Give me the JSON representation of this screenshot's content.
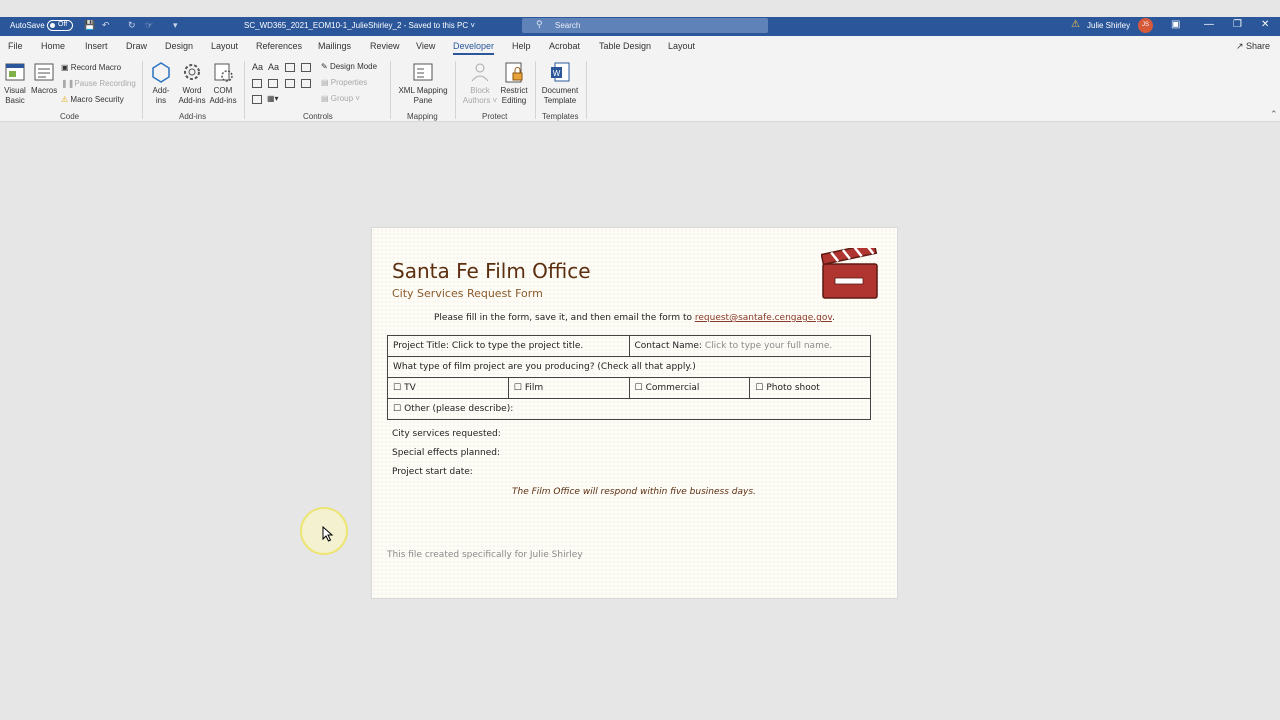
{
  "titlebar": {
    "autosave_label": "AutoSave",
    "autosave_state": "Off",
    "doc_title": "SC_WD365_2021_EOM10-1_JulieShirley_2",
    "save_status": "Saved to this PC",
    "search_placeholder": "Search",
    "user_name": "Julie Shirley",
    "user_initials": "JS"
  },
  "menu": {
    "tabs": [
      "File",
      "Home",
      "Insert",
      "Draw",
      "Design",
      "Layout",
      "References",
      "Mailings",
      "Review",
      "View",
      "Developer",
      "Help",
      "Acrobat",
      "Table Design",
      "Layout"
    ],
    "active_tab": "Developer",
    "share_label": "Share"
  },
  "ribbon": {
    "code": {
      "visual_basic": [
        "Visual",
        "Basic"
      ],
      "macros": "Macros",
      "record_macro": "Record Macro",
      "pause_recording": "Pause Recording",
      "macro_security": "Macro Security",
      "group_label": "Code"
    },
    "addins": {
      "add_ins": [
        "Add-",
        "ins"
      ],
      "word_add_ins": [
        "Word",
        "Add-ins"
      ],
      "com_add_ins": [
        "COM",
        "Add-ins"
      ],
      "group_label": "Add-ins"
    },
    "controls": {
      "design_mode": "Design Mode",
      "properties": "Properties",
      "group": "Group",
      "group_label": "Controls"
    },
    "mapping": {
      "xml_mapping_pane": [
        "XML Mapping",
        "Pane"
      ],
      "group_label": "Mapping"
    },
    "protect": {
      "block_authors": [
        "Block",
        "Authors"
      ],
      "restrict_editing": [
        "Restrict",
        "Editing"
      ],
      "group_label": "Protect"
    },
    "templates": {
      "document_template": [
        "Document",
        "Template"
      ],
      "group_label": "Templates"
    }
  },
  "document": {
    "title": "Santa Fe Film Office",
    "subtitle": "City Services Request Form",
    "instruction_prefix": "Please fill in the form, save it, and then email the form to ",
    "email": "request@santafe.cengage.gov",
    "instruction_suffix": ".",
    "table": {
      "project_title_label": "Project Title:",
      "project_title_placeholder": "Click to type the project title.",
      "contact_name_label": "Contact Name:",
      "contact_name_placeholder": "Click to type your full name.",
      "project_type_question": "What type of film project are you producing? (Check all that apply.)",
      "checkbox_glyph": "☐",
      "options": [
        "TV",
        "Film",
        "Commercial",
        "Photo shoot"
      ],
      "other_label": "Other (please describe):"
    },
    "fields": [
      "City services requested:",
      "Special effects planned:",
      "Project start date:"
    ],
    "response_note": "The Film Office will respond within five business days.",
    "footer_note": "This file created specifically for Julie Shirley"
  },
  "colors": {
    "title_bar": "#2b579a",
    "doc_title": "#5c2f10",
    "clapperboard": "#b03530"
  }
}
